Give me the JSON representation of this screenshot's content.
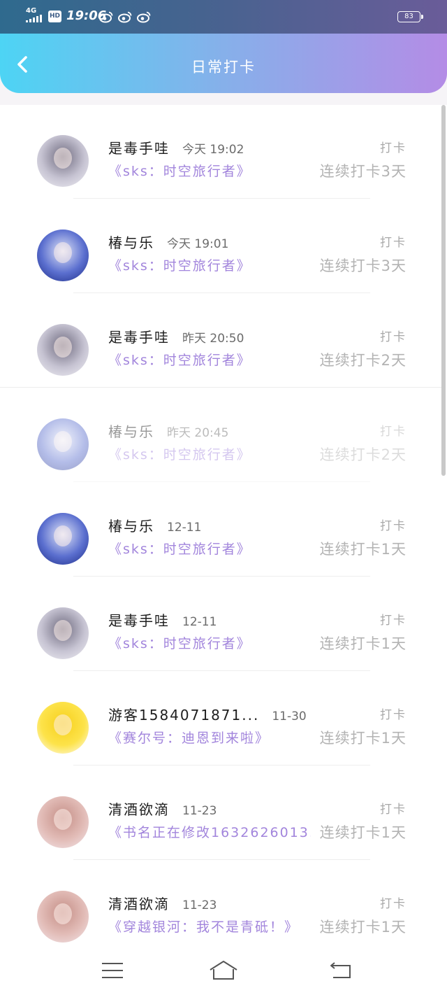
{
  "status_bar": {
    "network": "4G",
    "hd": "HD",
    "time": "19:06",
    "battery": "83",
    "icons": [
      "signal-icon",
      "weibo-icon",
      "weibo-icon",
      "weibo-icon",
      "battery-icon"
    ]
  },
  "header": {
    "title": "日常打卡",
    "back_icon": "chevron-left-icon",
    "gradient": [
      "#4dd4f4",
      "#b48ce6"
    ]
  },
  "theme": {
    "book_color": "#a285dc",
    "name_color": "#1e1e1e",
    "muted_color": "#b3b3b3"
  },
  "items": [
    {
      "name": "是毒手哇",
      "time": "今天 19:02",
      "book": "《sks：时空旅行者》",
      "action": "打卡",
      "streak": "连续打卡3天",
      "avatar_colors": [
        "#6e6a7e",
        "#c6c3d2",
        "#f1f0f5"
      ]
    },
    {
      "name": "椿与乐",
      "time": "今天 19:01",
      "book": "《sks：时空旅行者》",
      "action": "打卡",
      "streak": "连续打卡3天",
      "avatar_colors": [
        "#dfe4f7",
        "#5b6fcf",
        "#1d2c86"
      ]
    },
    {
      "name": "是毒手哇",
      "time": "昨天 20:50",
      "book": "《sks：时空旅行者》",
      "action": "打卡",
      "streak": "连续打卡2天",
      "avatar_colors": [
        "#6e6a7e",
        "#c6c3d2",
        "#f1f0f5"
      ]
    },
    {
      "name": "椿与乐",
      "time": "昨天 20:45",
      "book": "《sks：时空旅行者》",
      "action": "打卡",
      "streak": "连续打卡2天",
      "avatar_colors": [
        "#dfe4f7",
        "#5b6fcf",
        "#1d2c86"
      ]
    },
    {
      "name": "椿与乐",
      "time": "12-11",
      "book": "《sks：时空旅行者》",
      "action": "打卡",
      "streak": "连续打卡1天",
      "avatar_colors": [
        "#dfe4f7",
        "#5b6fcf",
        "#1d2c86"
      ]
    },
    {
      "name": "是毒手哇",
      "time": "12-11",
      "book": "《sks：时空旅行者》",
      "action": "打卡",
      "streak": "连续打卡1天",
      "avatar_colors": [
        "#6e6a7e",
        "#c6c3d2",
        "#f1f0f5"
      ]
    },
    {
      "name": "游客1584071871...",
      "time": "11-30",
      "book": "《赛尔号：迪恩到来啦》",
      "action": "打卡",
      "streak": "连续打卡1天",
      "avatar_colors": [
        "#f6cf1c",
        "#fde34a",
        "#fefefe"
      ]
    },
    {
      "name": "清酒欲滴",
      "time": "11-23",
      "book": "《书名正在修改1632626013...",
      "action": "打卡",
      "streak": "连续打卡1天",
      "avatar_colors": [
        "#c48e86",
        "#e2bcb7",
        "#f3e6ea"
      ]
    },
    {
      "name": "清酒欲滴",
      "time": "11-23",
      "book": "《穿越银河：我不是青砥！》",
      "action": "打卡",
      "streak": "连续打卡1天",
      "avatar_colors": [
        "#c48e86",
        "#e2bcb7",
        "#f3e6ea"
      ]
    }
  ],
  "nav": {
    "icons": [
      "menu-icon",
      "home-icon",
      "back-icon"
    ]
  }
}
